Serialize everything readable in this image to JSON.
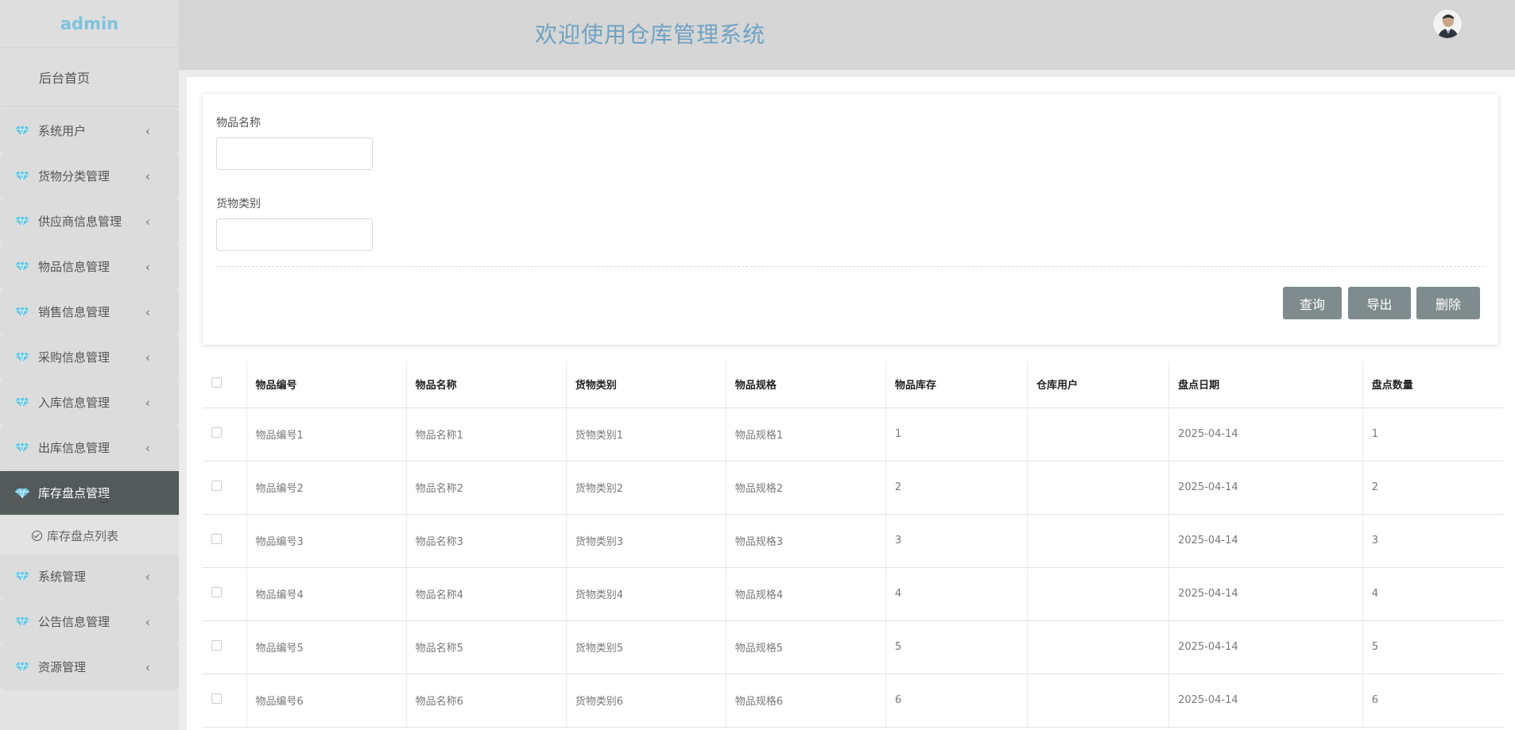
{
  "sidebar": {
    "brand": "admin",
    "home": "后台首页",
    "items": [
      {
        "label": "系统用户"
      },
      {
        "label": "货物分类管理"
      },
      {
        "label": "供应商信息管理"
      },
      {
        "label": "物品信息管理"
      },
      {
        "label": "销售信息管理"
      },
      {
        "label": "采购信息管理"
      },
      {
        "label": "入库信息管理"
      },
      {
        "label": "出库信息管理"
      },
      {
        "label": "库存盘点管理"
      },
      {
        "label": "系统管理"
      },
      {
        "label": "公告信息管理"
      },
      {
        "label": "资源管理"
      }
    ],
    "active_index": 8,
    "submenu": {
      "label": "库存盘点列表"
    },
    "chevron": "‹",
    "gem_color": "#6cc6e0"
  },
  "header": {
    "title": "欢迎使用仓库管理系统"
  },
  "search": {
    "fields": [
      {
        "label": "物品名称",
        "value": ""
      },
      {
        "label": "货物类别",
        "value": ""
      }
    ],
    "buttons": {
      "query": "查询",
      "export": "导出",
      "delete": "删除"
    }
  },
  "table": {
    "columns": [
      "物品编号",
      "物品名称",
      "货物类别",
      "物品规格",
      "物品库存",
      "仓库用户",
      "盘点日期",
      "盘点数量"
    ],
    "rows": [
      [
        "物品编号1",
        "物品名称1",
        "货物类别1",
        "物品规格1",
        "1",
        "",
        "2025-04-14",
        "1"
      ],
      [
        "物品编号2",
        "物品名称2",
        "货物类别2",
        "物品规格2",
        "2",
        "",
        "2025-04-14",
        "2"
      ],
      [
        "物品编号3",
        "物品名称3",
        "货物类别3",
        "物品规格3",
        "3",
        "",
        "2025-04-14",
        "3"
      ],
      [
        "物品编号4",
        "物品名称4",
        "货物类别4",
        "物品规格4",
        "4",
        "",
        "2025-04-14",
        "4"
      ],
      [
        "物品编号5",
        "物品名称5",
        "货物类别5",
        "物品规格5",
        "5",
        "",
        "2025-04-14",
        "5"
      ],
      [
        "物品编号6",
        "物品名称6",
        "货物类别6",
        "物品规格6",
        "6",
        "",
        "2025-04-14",
        "6"
      ]
    ]
  },
  "colors": {
    "accent_title": "#6fa2c3",
    "brand": "#7ec3de",
    "active_menu": "#545a5a",
    "button": "#7f8c8d"
  }
}
